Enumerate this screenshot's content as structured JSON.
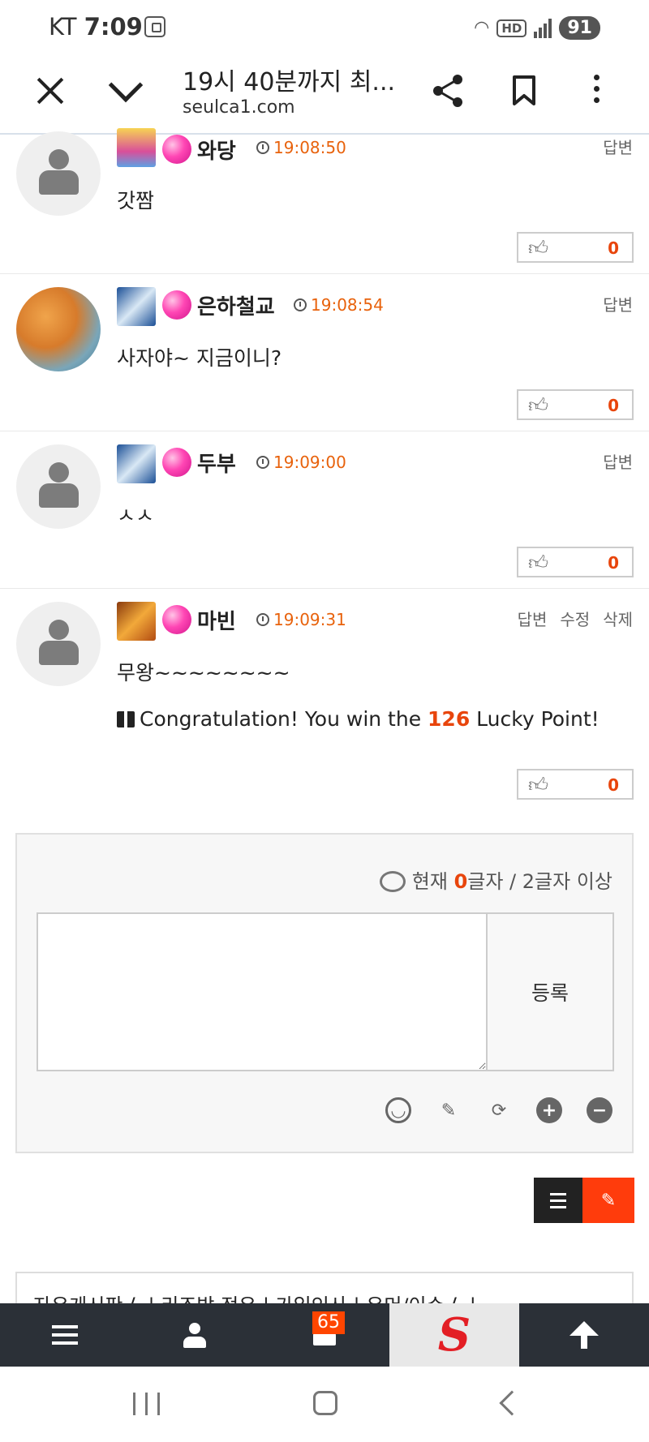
{
  "status_bar": {
    "carrier": "KT",
    "time": "7:09",
    "hd": "HD",
    "battery": "91"
  },
  "browser": {
    "title": "19시 40분까지 최...",
    "url": "seulca1.com"
  },
  "comments": [
    {
      "nick": "와당",
      "time": "19:08:50",
      "text": "갓짬",
      "likes": "0",
      "actions": [
        "답변"
      ]
    },
    {
      "nick": "은하철교",
      "time": "19:08:54",
      "text": "사자야~ 지금이니?",
      "likes": "0",
      "actions": [
        "답변"
      ]
    },
    {
      "nick": "두부",
      "time": "19:09:00",
      "text": "ㅅㅅ",
      "likes": "0",
      "actions": [
        "답변"
      ]
    },
    {
      "nick": "마빈",
      "time": "19:09:31",
      "text": "무왕~~~~~~~~",
      "likes": "0",
      "actions": [
        "답변",
        "수정",
        "삭제"
      ],
      "lucky": {
        "prefix": "Congratulation! You win the ",
        "points": "126",
        "suffix": " Lucky Point!"
      }
    }
  ],
  "editor": {
    "counter_prefix": "현재 ",
    "count": "0",
    "counter_suffix": "글자 / 2글자 이상",
    "submit": "등록"
  },
  "footer_links": "자유게시판 ϟ  |  리조밤 정유  |  가입인사  |  유머/이슈 ϟ  |",
  "bottom_nav": {
    "notification_count": "65",
    "logo": "S"
  },
  "colors": {
    "accent": "#e8450c",
    "nav_bg": "#2b3037",
    "write_btn": "#ff3c0c"
  }
}
